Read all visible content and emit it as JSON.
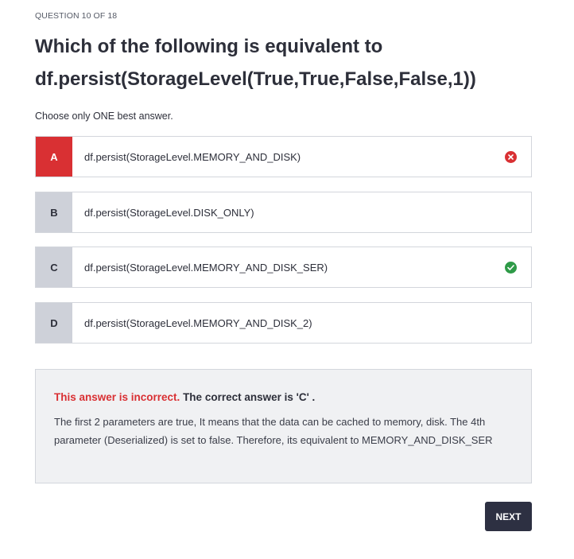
{
  "quiz": {
    "counter": "QUESTION 10 OF 18",
    "question_line1": "Which of the following is equivalent to",
    "question_line2": "df.persist(StorageLevel(True,True,False,False,1))",
    "instruction": "Choose only ONE best answer."
  },
  "options": [
    {
      "letter": "A",
      "text": "df.persist(StorageLevel.MEMORY_AND_DISK)",
      "state": "selected-incorrect",
      "icon": "x-circle-icon"
    },
    {
      "letter": "B",
      "text": "df.persist(StorageLevel.DISK_ONLY)",
      "state": "unselected",
      "icon": ""
    },
    {
      "letter": "C",
      "text": "df.persist(StorageLevel.MEMORY_AND_DISK_SER)",
      "state": "correct",
      "icon": "check-circle-icon"
    },
    {
      "letter": "D",
      "text": "df.persist(StorageLevel.MEMORY_AND_DISK_2)",
      "state": "unselected",
      "icon": ""
    }
  ],
  "feedback": {
    "incorrect_label": "This answer is incorrect.",
    "correct_label": " The correct answer is 'C' .",
    "explanation": "The first 2 parameters are true, It means that the data can be cached to memory, disk. The 4th parameter (Deserialized) is set to false. Therefore, its equivalent to MEMORY_AND_DISK_SER"
  },
  "navigation": {
    "next_label": "NEXT"
  },
  "colors": {
    "incorrect": "#d93033",
    "correct": "#2e9a47",
    "letter_bg": "#ced1d9",
    "button_bg": "#2d3042",
    "feedback_bg": "#f0f1f3"
  }
}
